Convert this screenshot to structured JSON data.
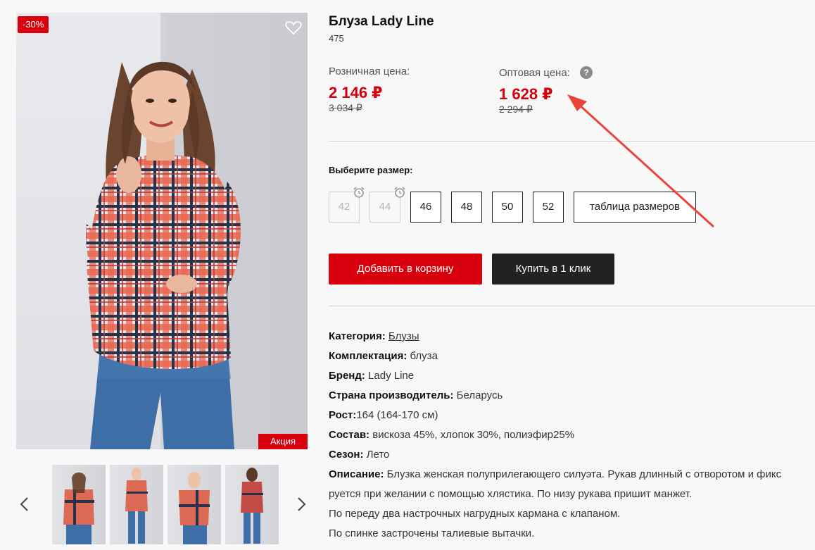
{
  "product": {
    "title": "Блуза Lady Line",
    "sku": "475",
    "badge_discount": "-30%",
    "badge_promo": "Акция"
  },
  "prices": {
    "retail_label": "Розничная цена:",
    "retail_now": "2 146 ₽",
    "retail_old": "3 034 ₽",
    "wholesale_label": "Оптовая цена:",
    "wholesale_now": "1 628 ₽",
    "wholesale_old": "2 294 ₽",
    "help_glyph": "?"
  },
  "sizes": {
    "label": "Выберите размер:",
    "items": [
      {
        "label": "42",
        "available": false
      },
      {
        "label": "44",
        "available": false
      },
      {
        "label": "46",
        "available": true
      },
      {
        "label": "48",
        "available": true
      },
      {
        "label": "50",
        "available": true
      },
      {
        "label": "52",
        "available": true
      }
    ],
    "table_label": "таблица размеров"
  },
  "actions": {
    "add_to_cart": "Добавить в корзину",
    "buy_one_click": "Купить в 1 клик"
  },
  "properties": {
    "category_key": "Категория:",
    "category_value": "Блузы",
    "set_key": "Комплектация:",
    "set_value": "блуза",
    "brand_key": "Бренд:",
    "brand_value": "Lady Line",
    "country_key": "Страна производитель:",
    "country_value": "Беларусь",
    "height_key": "Рост:",
    "height_value": "164 (164-170 см)",
    "composition_key": "Состав:",
    "composition_value": "вискоза 45%, хлопок 30%, полиэфир25%",
    "season_key": "Сезон:",
    "season_value": "Лето",
    "description_key": "Описание:",
    "description_lines": [
      "Блузка женская полуприлегающего силуэта. Рукав длинный с отворотом и фикс",
      "руется при желании с помощью хлястика. По низу рукава пришит манжет.",
      "По переду два настрочных нагрудных кармана с клапаном.",
      "По спинке застрочены талиевые вытачки."
    ]
  },
  "gallery": {
    "thumbnail_count": 4,
    "prev_icon": "chevron-left-icon",
    "next_icon": "chevron-right-icon"
  },
  "colors": {
    "accent_red": "#d9000d",
    "price_red": "#d4000d",
    "dark_button": "#222222",
    "annotation_arrow": "#e8443a"
  }
}
